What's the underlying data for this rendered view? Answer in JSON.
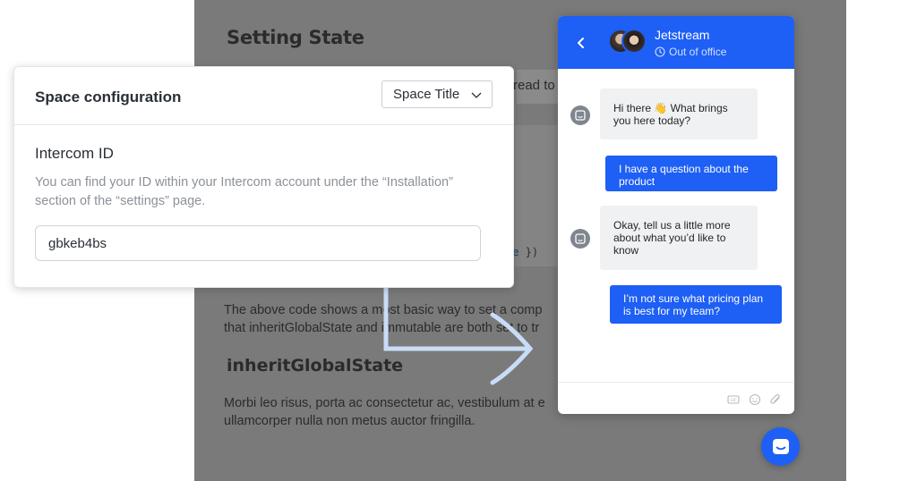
{
  "background_doc": {
    "title": "Setting State",
    "code_top_text": "read to",
    "code_bottom_keyword": "ue",
    "code_bottom_tail": " })",
    "paragraph1_line1": "The above code shows a most basic way to set a comp",
    "paragraph1_line2": "that inheritGlobalState and immutable are both set to tr",
    "subtitle": "inheritGlobalState",
    "paragraph2_line1": "Morbi leo risus, porta ac consectetur ac, vestibulum at e",
    "paragraph2_line2": "ullamcorper nulla non metus auctor fringilla."
  },
  "config": {
    "title": "Space configuration",
    "select_value": "Space Title",
    "field_label": "Intercom ID",
    "field_help": "You can find your ID within your Intercom account under the “Installation” section of the “settings” page.",
    "field_value": "gbkeb4bs"
  },
  "chat": {
    "agent_name": "Jetstream",
    "agent_status": "Out of office",
    "messages": [
      {
        "from": "bot",
        "text": "Hi there 👋 What brings you here today?"
      },
      {
        "from": "user",
        "text": "I have a question about the product"
      },
      {
        "from": "bot",
        "text": "Okay, tell us a little more about what you’d like to know"
      },
      {
        "from": "user",
        "text": "I’m not sure what pricing plan is best for my team?"
      }
    ],
    "composer_icons": [
      "gif-icon",
      "emoji-icon",
      "attachment-icon"
    ]
  },
  "colors": {
    "accent": "#1e5ff5",
    "background_overlay": "#7a7a7a",
    "arrow": "#c9dcf7"
  }
}
